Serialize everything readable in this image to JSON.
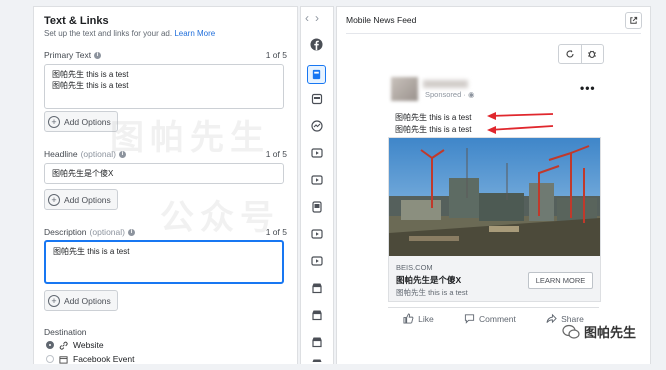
{
  "left_panel": {
    "title": "Text & Links",
    "subtitle": "Set up the text and links for your ad.",
    "learn_more": "Learn More",
    "primary_text": {
      "label": "Primary Text",
      "count": "1 of 5",
      "lines": [
        "图帕先生 this is a test",
        "图帕先生 this is a test"
      ]
    },
    "headline": {
      "label": "Headline",
      "optional": "(optional)",
      "count": "1 of 5",
      "value": "图帕先生是个傻X"
    },
    "description": {
      "label": "Description",
      "optional": "(optional)",
      "count": "1 of 5",
      "value": "图帕先生 this is a test"
    },
    "add_options": "Add Options",
    "destination": {
      "label": "Destination",
      "options": [
        "Website",
        "Facebook Event"
      ],
      "selected": "Website"
    }
  },
  "preview": {
    "title": "Mobile News Feed",
    "sponsored": "Sponsored · ",
    "body_lines": [
      "图帕先生 this is a test",
      "图帕先生 this is a test"
    ],
    "domain": "BEIS.COM",
    "headline": "图帕先生是个傻X",
    "description": "图帕先生 this is a test",
    "cta": "LEARN MORE",
    "actions": [
      "Like",
      "Comment",
      "Share"
    ]
  },
  "watermark": {
    "brand": "图帕先生",
    "big1": "图帕先生",
    "big2": "公众号"
  },
  "colors": {
    "accent": "#1877f2",
    "arrow": "#e0272d"
  },
  "icons": [
    "facebook-icon",
    "mobile-feed-icon",
    "instagram-icon",
    "messenger-icon",
    "video-icon",
    "story-icon",
    "marketplace-icon"
  ]
}
